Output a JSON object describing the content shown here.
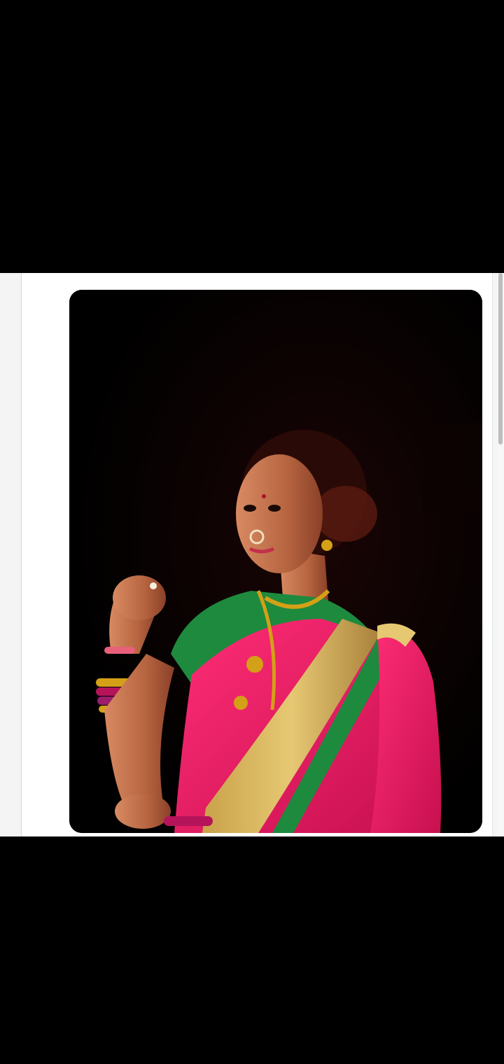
{
  "viewer": {
    "background_color": "#000000"
  },
  "screenshot": {
    "page_background": "#ffffff",
    "outer_background": "#f4f4f4",
    "accent_border": "#f3c9d3"
  },
  "photo": {
    "subject": "portrait",
    "backdrop_color": "#000000",
    "saree_color": "#e8185f",
    "blouse_color": "#1e8a3e",
    "jewelry_color": "#d4a017"
  },
  "scrollbar": {
    "visible": true,
    "thumb_color": "#bdbdbd"
  }
}
